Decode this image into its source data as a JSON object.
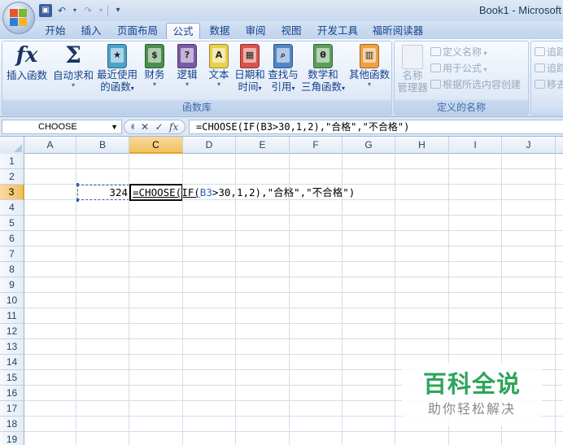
{
  "window": {
    "title": "Book1 - Microsoft"
  },
  "quick_access": {
    "items": [
      "save-icon",
      "undo-icon",
      "redo-icon",
      "customize-icon"
    ]
  },
  "tabs": [
    {
      "label": "开始",
      "active": false
    },
    {
      "label": "插入",
      "active": false
    },
    {
      "label": "页面布局",
      "active": false
    },
    {
      "label": "公式",
      "active": true
    },
    {
      "label": "数据",
      "active": false
    },
    {
      "label": "审阅",
      "active": false
    },
    {
      "label": "视图",
      "active": false
    },
    {
      "label": "开发工具",
      "active": false
    },
    {
      "label": "福昕阅读器",
      "active": false
    }
  ],
  "ribbon": {
    "function_library": {
      "label": "函数库",
      "insert_function": {
        "label": "插入函数"
      },
      "autosum": {
        "label": "自动求和"
      },
      "recently_used": {
        "label": "最近使用",
        "label2": "的函数"
      },
      "financial": {
        "label": "财务",
        "color": "#4a8f4e"
      },
      "logical": {
        "label": "逻辑",
        "color": "#7a5aa8"
      },
      "text": {
        "label": "文本",
        "color": "#e8d24a"
      },
      "datetime": {
        "label": "日期和",
        "label2": "时间",
        "color": "#d9534a"
      },
      "lookup": {
        "label": "查找与",
        "label2": "引用",
        "color": "#4f86c7"
      },
      "math": {
        "label": "数学和",
        "label2": "三角函数",
        "color": "#5a9e5a"
      },
      "more": {
        "label": "其他函数",
        "color": "#f0a040"
      }
    },
    "defined_names": {
      "label": "定义的名称",
      "name_manager": {
        "label": "名称",
        "label2": "管理器"
      },
      "define_name": "定义名称",
      "use_in_formula": "用于公式",
      "create_from_selection": "根据所选内容创建"
    },
    "formula_auditing": {
      "trace_precedents": "追踪",
      "trace_dependents": "追踪",
      "remove_arrows": "移去"
    }
  },
  "formula_bar": {
    "name_box": "CHOOSE",
    "formula": "=CHOOSE(IF(B3>30,1,2),\"合格\",\"不合格\")"
  },
  "grid": {
    "columns": [
      "A",
      "B",
      "C",
      "D",
      "E",
      "F",
      "G",
      "H",
      "I",
      "J"
    ],
    "rows": [
      "1",
      "2",
      "3",
      "4",
      "5",
      "6",
      "7",
      "8",
      "9",
      "10",
      "11",
      "12",
      "13",
      "14",
      "15",
      "16",
      "17",
      "18",
      "19"
    ],
    "active_column": "C",
    "active_row": "3",
    "cells": {
      "B3": "324",
      "C3": {
        "prefix": "=CHOOSE(IF(",
        "ref": "B3",
        "suffix": ">30,1,2),\"合格\",\"不合格\")"
      }
    }
  },
  "watermark": {
    "title": "百科全说",
    "subtitle": "助你轻松解决"
  },
  "colors": {
    "accent": "#15428b",
    "selected_header": "#f1c15f",
    "reference": "#2f5fb5",
    "watermark": "#2ca55a"
  }
}
